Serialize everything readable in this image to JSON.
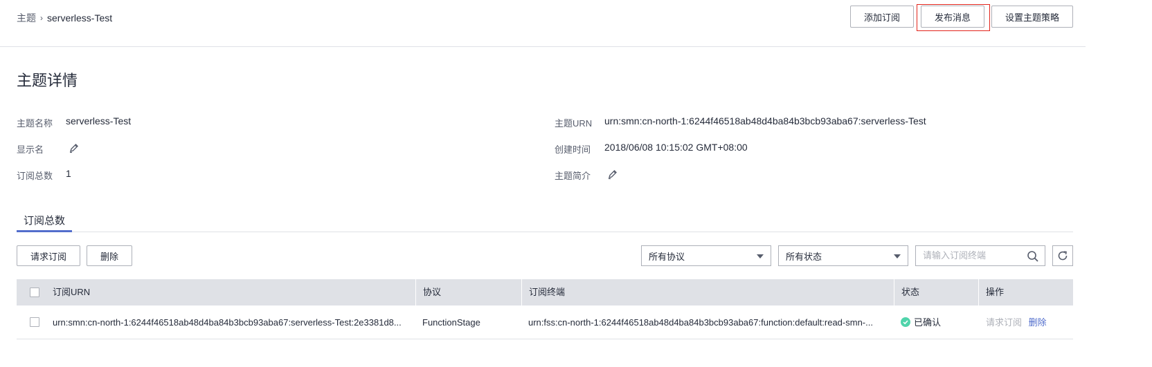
{
  "breadcrumb": {
    "parent": "主题",
    "separator": "›",
    "current": "serverless-Test"
  },
  "header_buttons": {
    "add_subscription": "添加订阅",
    "publish_message": "发布消息",
    "topic_policy": "设置主题策略"
  },
  "section_title": "主题详情",
  "details": {
    "topic_name_label": "主题名称",
    "topic_name_value": "serverless-Test",
    "display_name_label": "显示名",
    "sub_count_label": "订阅总数",
    "sub_count_value": "1",
    "urn_label": "主题URN",
    "urn_value": "urn:smn:cn-north-1:6244f46518ab48d4ba84b3bcb93aba67:serverless-Test",
    "created_label": "创建时间",
    "created_value": "2018/06/08 10:15:02 GMT+08:00",
    "intro_label": "主题简介"
  },
  "tab": {
    "label": "订阅总数"
  },
  "toolbar": {
    "request_subscription": "请求订阅",
    "delete": "删除",
    "protocol_select": "所有协议",
    "status_select": "所有状态",
    "search_placeholder": "请输入订阅终端"
  },
  "table": {
    "headers": {
      "urn": "订阅URN",
      "protocol": "协议",
      "endpoint": "订阅终端",
      "status": "状态",
      "action": "操作"
    },
    "rows": [
      {
        "urn": "urn:smn:cn-north-1:6244f46518ab48d4ba84b3bcb93aba67:serverless-Test:2e3381d8...",
        "protocol": "FunctionStage",
        "endpoint": "urn:fss:cn-north-1:6244f46518ab48d4ba84b3bcb93aba67:function:default:read-smn-...",
        "status": "已确认",
        "action_request": "请求订阅",
        "action_delete": "删除"
      }
    ]
  },
  "colors": {
    "accent": "#526ecc",
    "highlight": "#e2231a",
    "status_ok": "#50d4ab"
  }
}
